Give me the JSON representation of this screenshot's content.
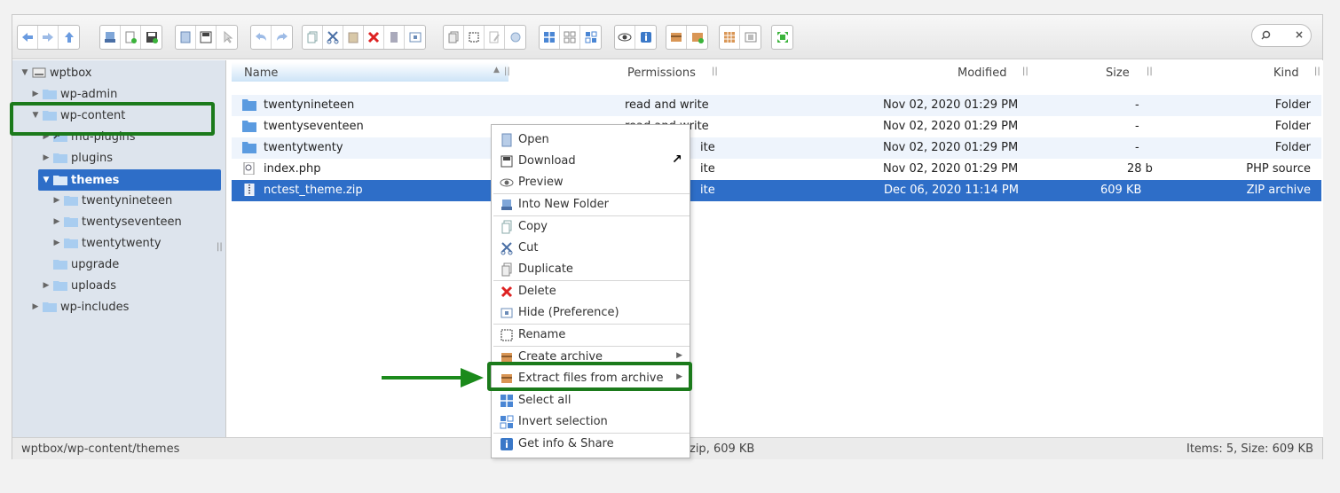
{
  "toolbar": {
    "groups": [
      [
        "back-icon",
        "forward-icon",
        "up-icon"
      ],
      [
        "reload-icon",
        "new-file-icon",
        "save-icon"
      ],
      [
        "open-icon",
        "download-icon",
        "select-icon"
      ],
      [
        "undo-icon",
        "redo-icon"
      ],
      [
        "copy-icon",
        "cut-icon",
        "paste-icon",
        "delete-icon",
        "hide-icon",
        "info-box-icon"
      ],
      [
        "duplicate-icon",
        "rename-icon",
        "edit-icon",
        "resize-icon"
      ],
      [
        "view-icons-icon",
        "view-small-icon",
        "view-list-icon"
      ],
      [
        "preview-icon",
        "info-icon"
      ],
      [
        "archive-icon",
        "extract-icon"
      ],
      [
        "select-all-icon",
        "invert-icon"
      ],
      [
        "fullscreen-icon"
      ]
    ],
    "search": {
      "placeholder": "",
      "clear_symbol": "×"
    }
  },
  "sidebar": {
    "root": "wptbox",
    "items": [
      {
        "label": "wp-admin"
      },
      {
        "label": "wp-content"
      },
      {
        "label": "mu-plugins"
      },
      {
        "label": "plugins"
      },
      {
        "label": "themes"
      },
      {
        "label": "twentynineteen"
      },
      {
        "label": "twentyseventeen"
      },
      {
        "label": "twentytwenty"
      },
      {
        "label": "upgrade"
      },
      {
        "label": "uploads"
      },
      {
        "label": "wp-includes"
      }
    ]
  },
  "filelist": {
    "columns": {
      "name": "Name",
      "permissions": "Permissions",
      "modified": "Modified",
      "size": "Size",
      "kind": "Kind"
    },
    "rows": [
      {
        "name": "twentynineteen",
        "permissions": "read and write",
        "modified": "Nov 02, 2020 01:29 PM",
        "size": "-",
        "kind": "Folder"
      },
      {
        "name": "twentyseventeen",
        "permissions": "read and write",
        "modified": "Nov 02, 2020 01:29 PM",
        "size": "-",
        "kind": "Folder"
      },
      {
        "name": "twentytwenty",
        "permissions": "ite",
        "modified": "Nov 02, 2020 01:29 PM",
        "size": "-",
        "kind": "Folder"
      },
      {
        "name": "index.php",
        "permissions": "ite",
        "modified": "Nov 02, 2020 01:29 PM",
        "size": "28 b",
        "kind": "PHP source"
      },
      {
        "name": "nctest_theme.zip",
        "permissions": "ite",
        "modified": "Dec 06, 2020 11:14 PM",
        "size": "609 KB",
        "kind": "ZIP archive"
      }
    ]
  },
  "statusbar": {
    "path": "wptbox/wp-content/themes",
    "selection": "zip, 609 KB",
    "summary": "Items: 5, Size: 609 KB"
  },
  "context_menu": {
    "items": [
      {
        "label": "Open",
        "icon": "open-icon"
      },
      {
        "label": "Download",
        "icon": "download-icon"
      },
      {
        "label": "Preview",
        "icon": "preview-icon"
      },
      {
        "label": "Into New Folder",
        "icon": "new-folder-icon"
      },
      {
        "label": "Copy",
        "icon": "copy-icon"
      },
      {
        "label": "Cut",
        "icon": "cut-icon"
      },
      {
        "label": "Duplicate",
        "icon": "duplicate-icon"
      },
      {
        "label": "Delete",
        "icon": "delete-icon"
      },
      {
        "label": "Hide (Preference)",
        "icon": "hide-icon"
      },
      {
        "label": "Rename",
        "icon": "rename-icon"
      },
      {
        "label": "Create archive",
        "icon": "archive-icon"
      },
      {
        "label": "Extract files from archive",
        "icon": "extract-icon"
      },
      {
        "label": "Select all",
        "icon": "select-all-icon"
      },
      {
        "label": "Invert selection",
        "icon": "invert-icon"
      },
      {
        "label": "Get info & Share",
        "icon": "info-icon"
      }
    ]
  },
  "colors": {
    "selection": "#2e6ec8",
    "highlight": "#1b7a1b",
    "sidebar": "#dde4ed"
  }
}
